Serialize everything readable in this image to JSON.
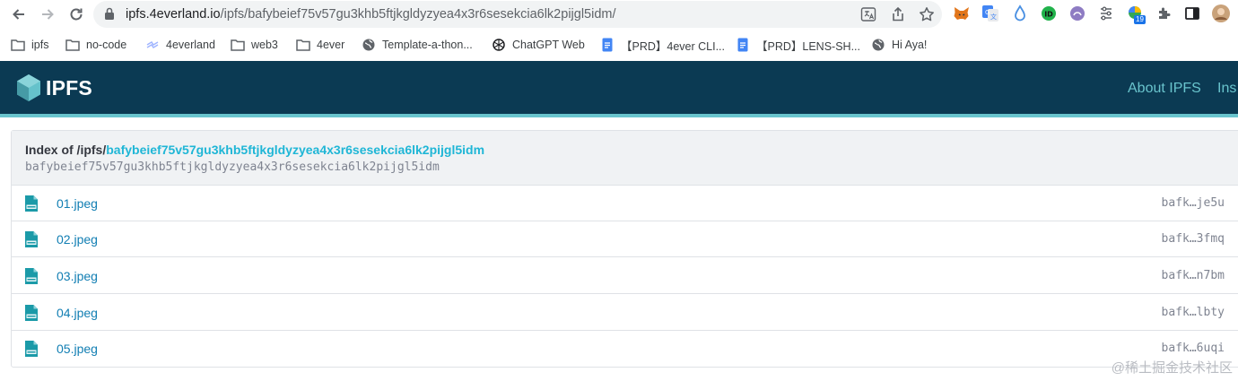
{
  "browser": {
    "url_host": "ipfs.4everland.io",
    "url_path": "/ipfs/bafybeief75v57gu3khb5ftjkgldyzyea4x3r6sesekcia6lk2pijgl5idm/",
    "extension_badge": "19",
    "bookmarks": [
      {
        "label": "ipfs",
        "icon": "folder-icon"
      },
      {
        "label": "no-code",
        "icon": "folder-icon"
      },
      {
        "label": "4everland",
        "icon": "site-icon"
      },
      {
        "label": "web3",
        "icon": "folder-icon"
      },
      {
        "label": "4ever",
        "icon": "folder-icon"
      },
      {
        "label": "Template-a-thon...",
        "icon": "globe-icon"
      },
      {
        "label": "ChatGPT Web",
        "icon": "chatgpt-icon"
      },
      {
        "label": "【PRD】4ever CLI...",
        "icon": "doc-icon"
      },
      {
        "label": "【PRD】LENS-SH...",
        "icon": "doc-icon"
      },
      {
        "label": "Hi Aya!",
        "icon": "globe-icon"
      }
    ]
  },
  "header": {
    "logo_text": "IPFS",
    "nav": [
      "About IPFS",
      "Ins"
    ]
  },
  "listing": {
    "index_prefix": "Index of /ipfs/",
    "cid": "bafybeief75v57gu3khb5ftjkgldyzyea4x3r6sesekcia6lk2pijgl5idm",
    "cid_sub": "bafybeief75v57gu3khb5ftjkgldyzyea4x3r6sesekcia6lk2pijgl5idm",
    "files": [
      {
        "name": "01.jpeg",
        "cid": "bafk…je5u"
      },
      {
        "name": "02.jpeg",
        "cid": "bafk…3fmq"
      },
      {
        "name": "03.jpeg",
        "cid": "bafk…n7bm"
      },
      {
        "name": "04.jpeg",
        "cid": "bafk…lbty"
      },
      {
        "name": "05.jpeg",
        "cid": "bafk…6uqi"
      }
    ]
  },
  "watermark": "@稀土掘金技术社区",
  "colors": {
    "header_bg": "#0b3a53",
    "accent": "#69c4cd",
    "link": "#117eb3",
    "cid_link": "#1fb6d6"
  }
}
